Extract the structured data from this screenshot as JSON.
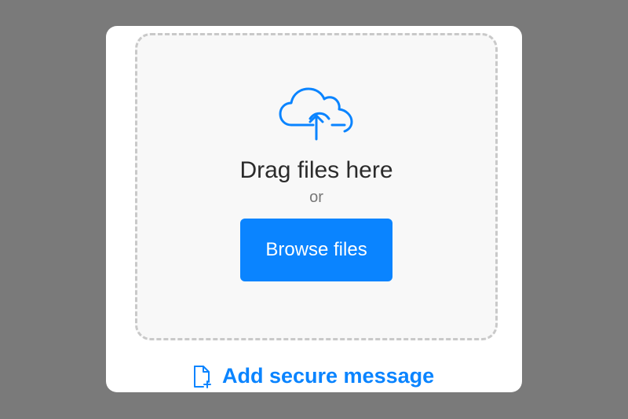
{
  "upload": {
    "icon": "cloud-upload-icon",
    "title": "Drag files here",
    "or": "or",
    "browse_label": "Browse files"
  },
  "secure_message": {
    "icon": "document-add-icon",
    "label": "Add secure message"
  },
  "colors": {
    "accent": "#0a84ff",
    "background": "#7a7a7a",
    "card": "#ffffff",
    "dropzone": "#f8f8f8",
    "dashed_border": "#c9c9c9"
  }
}
